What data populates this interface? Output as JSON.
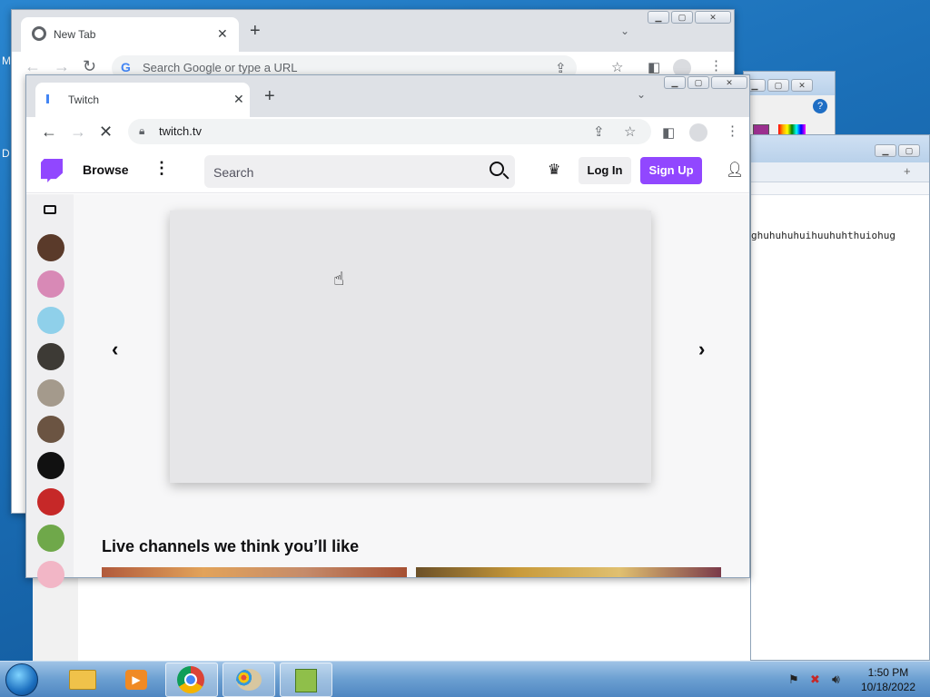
{
  "desktop": {
    "left_label_m": "M",
    "left_label_d": "D"
  },
  "back_text_window": {
    "text_line": "ghuhuhuhuihuuhuhthuiohug"
  },
  "browser_back": {
    "tab_title": "New Tab",
    "omnibox_placeholder": "Search Google or type a URL"
  },
  "browser_front": {
    "tab_title": "Twitch",
    "url": "twitch.tv"
  },
  "twitch": {
    "browse_label": "Browse",
    "search_placeholder": "Search",
    "login_label": "Log In",
    "signup_label": "Sign Up",
    "section_title": "Live channels we think you’ll like",
    "accent_color": "#9147ff"
  },
  "sidebar": {
    "avatars": [
      {
        "color": "#5a3a2a"
      },
      {
        "color": "#d889b6"
      },
      {
        "color": "#8fd0ea"
      },
      {
        "color": "#3d3a35"
      },
      {
        "color": "#a49a8c"
      },
      {
        "color": "#6b5442"
      },
      {
        "color": "#111111"
      },
      {
        "color": "#c62828"
      },
      {
        "color": "#6fa84a"
      },
      {
        "color": "#f2b6c6"
      }
    ]
  },
  "taskbar": {
    "time": "1:50 PM",
    "date": "10/18/2022"
  }
}
